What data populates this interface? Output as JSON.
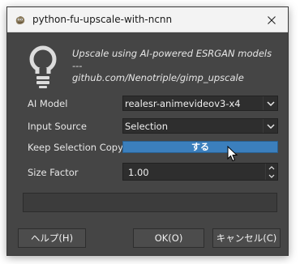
{
  "window": {
    "title": "python-fu-upscale-with-ncnn"
  },
  "description": {
    "line1": "Upscale using AI-powered ESRGAN models",
    "line2": "---",
    "line3": "github.com/Nenotriple/gimp_upscale"
  },
  "fields": {
    "ai_model_label": "AI Model",
    "ai_model_value": "realesr-animevideov3-x4",
    "input_source_label": "Input Source",
    "input_source_value": "Selection",
    "keep_selection_label": "Keep Selection Copy",
    "keep_selection_value": "する",
    "size_factor_label": "Size Factor",
    "size_factor_value": "1.00"
  },
  "buttons": {
    "help": "ヘルプ(H)",
    "ok": "OK(O)",
    "cancel": "キャンセル(C)"
  },
  "colors": {
    "dialog_bg": "#454545",
    "toggle_active": "#3b7fbd"
  },
  "icons": {
    "app": "gimp-icon",
    "header": "lightbulb-icon",
    "close": "close-icon",
    "dropdown": "chevron-down-icon",
    "cursor": "mouse-pointer-icon"
  }
}
